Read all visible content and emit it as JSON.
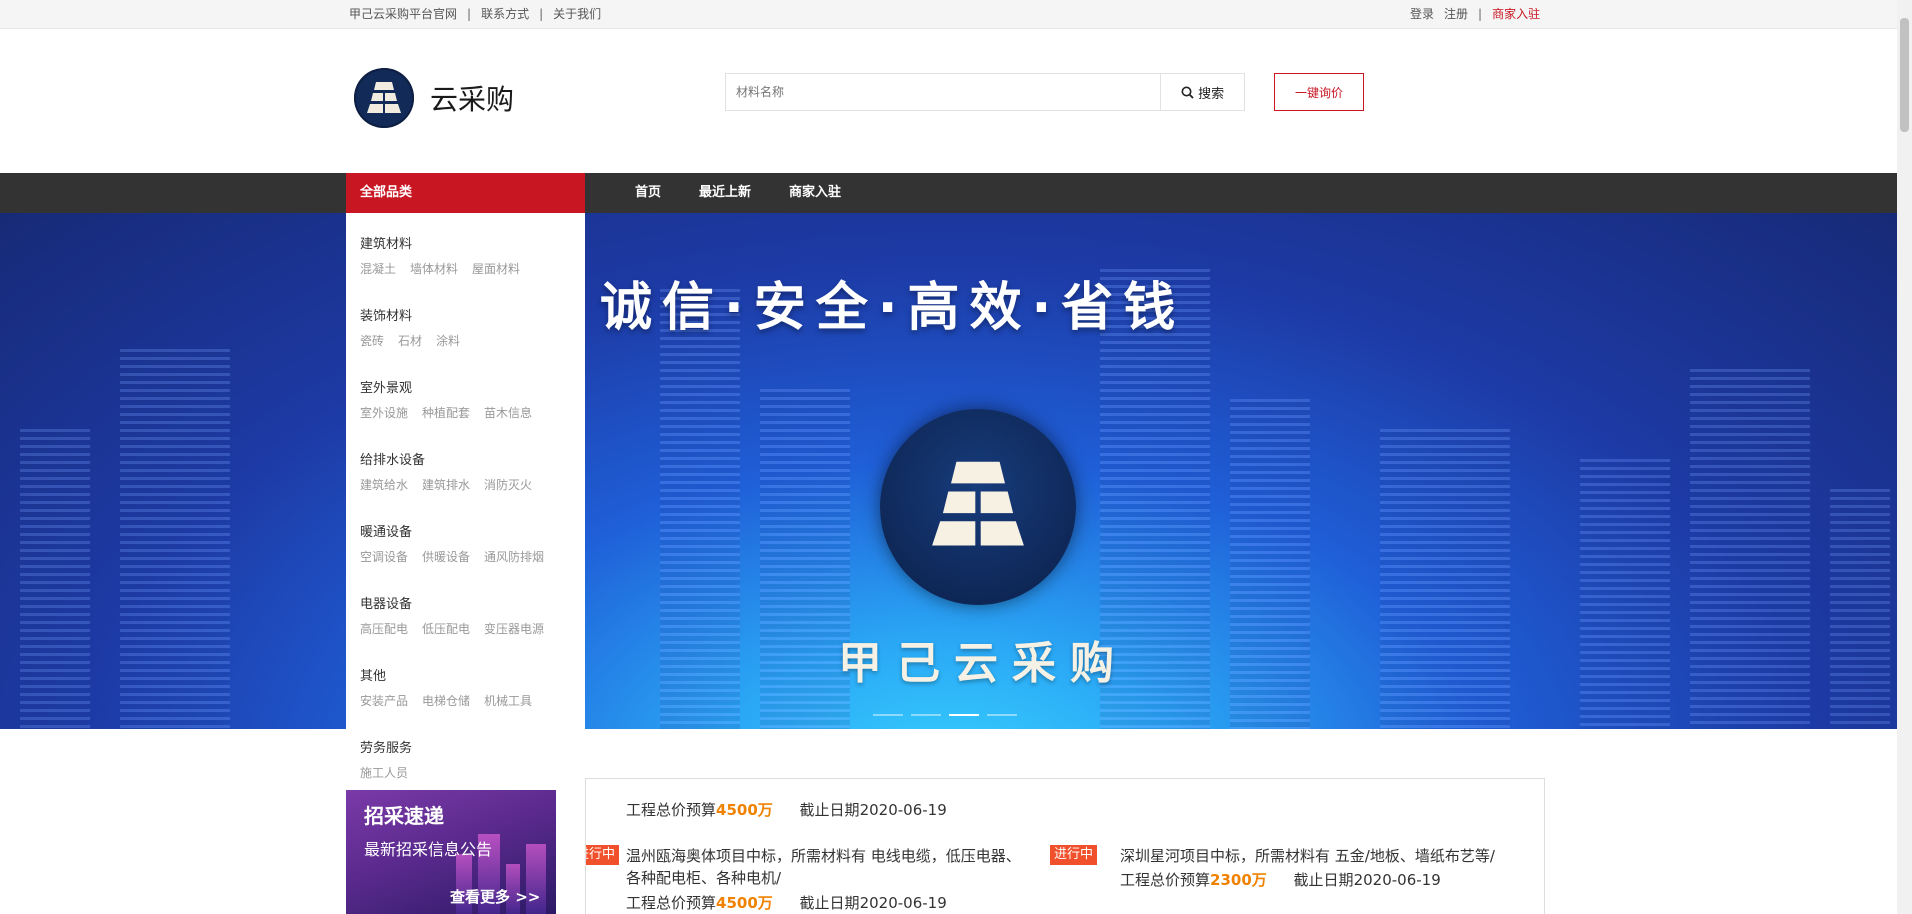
{
  "topbar": {
    "links": [
      "甲己云采购平台官网",
      "联系方式",
      "关于我们"
    ],
    "separator": "|",
    "login": "登录",
    "register": "注册",
    "merchant": "商家入驻"
  },
  "header": {
    "brand": "云采购",
    "search_placeholder": "材料名称",
    "search_button": "搜索",
    "quote_button": "一键询价"
  },
  "nav": {
    "all_categories": "全部品类",
    "links": [
      "首页",
      "最近上新",
      "商家入驻"
    ]
  },
  "banner": {
    "slogan": "诚信·安全·高效·省钱",
    "brand_name": "甲己云采购",
    "slides": 4,
    "active_slide": 3
  },
  "categories": [
    {
      "title": "建筑材料",
      "subs": [
        "混凝土",
        "墙体材料",
        "屋面材料"
      ]
    },
    {
      "title": "装饰材料",
      "subs": [
        "瓷砖",
        "石材",
        "涂料"
      ]
    },
    {
      "title": "室外景观",
      "subs": [
        "室外设施",
        "种植配套",
        "苗木信息"
      ]
    },
    {
      "title": "给排水设备",
      "subs": [
        "建筑给水",
        "建筑排水",
        "消防灭火"
      ]
    },
    {
      "title": "暖通设备",
      "subs": [
        "空调设备",
        "供暖设备",
        "通风防排烟"
      ]
    },
    {
      "title": "电器设备",
      "subs": [
        "高压配电",
        "低压配电",
        "变压器电源"
      ]
    },
    {
      "title": "其他",
      "subs": [
        "安装产品",
        "电梯仓储",
        "机械工具"
      ]
    },
    {
      "title": "劳务服务",
      "subs": [
        "施工人员"
      ]
    }
  ],
  "promo": {
    "title": "招采速递",
    "subtitle": "最新招采信息公告",
    "more": "查看更多 >>"
  },
  "tenders": {
    "badge": "进行中",
    "budget_label": "工程总价预算",
    "deadline_label": "截止日期",
    "top_amount": "4500万",
    "top_deadline": "2020-06-19",
    "left": {
      "desc1": "温州瓯海奥体项目中标，所需材料有 电线电缆，低压电器、",
      "desc2": "各种配电柜、各种电机/",
      "amount": "4500万",
      "deadline": "2020-06-19"
    },
    "right": {
      "desc1": "深圳星河项目中标，所需材料有 五金/地板、墙纸布艺等/",
      "amount": "2300万",
      "deadline": "2020-06-19"
    }
  }
}
